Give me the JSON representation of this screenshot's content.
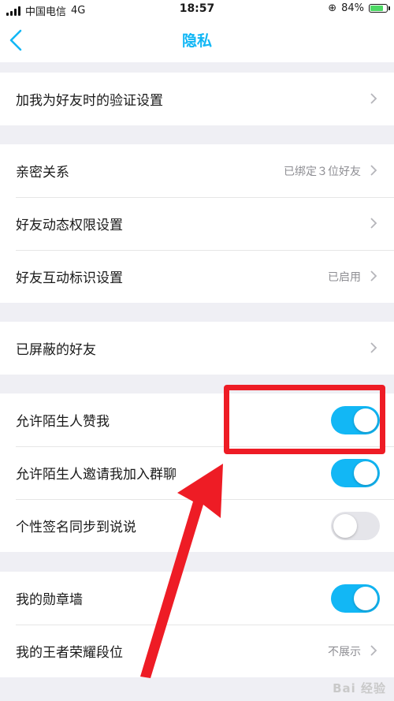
{
  "status_bar": {
    "carrier": "中国电信",
    "network": "4G",
    "time": "18:57",
    "battery": "84%",
    "battery_level": 0.84,
    "battery_color": "#4cd964"
  },
  "nav": {
    "title": "隐私",
    "back_icon": "chevron-left-icon",
    "accent": "#12b7f5"
  },
  "groups": [
    {
      "rows": [
        {
          "label": "加我为好友时的验证设置"
        }
      ]
    },
    {
      "rows": [
        {
          "label": "亲密关系",
          "value": "已绑定３位好友"
        },
        {
          "label": "好友动态权限设置"
        },
        {
          "label": "好友互动标识设置",
          "value": "已启用"
        }
      ]
    },
    {
      "rows": [
        {
          "label": "已屏蔽的好友"
        }
      ]
    },
    {
      "rows": [
        {
          "label": "允许陌生人赞我",
          "toggle": true
        },
        {
          "label": "允许陌生人邀请我加入群聊",
          "toggle": true
        },
        {
          "label": "个性签名同步到说说",
          "toggle": false
        }
      ]
    },
    {
      "rows": [
        {
          "label": "我的勋章墙",
          "toggle": true
        },
        {
          "label": "我的王者荣耀段位",
          "value": "不展示"
        }
      ]
    }
  ],
  "annotation_color": "#ee1c25",
  "watermark": "Bai 经验"
}
